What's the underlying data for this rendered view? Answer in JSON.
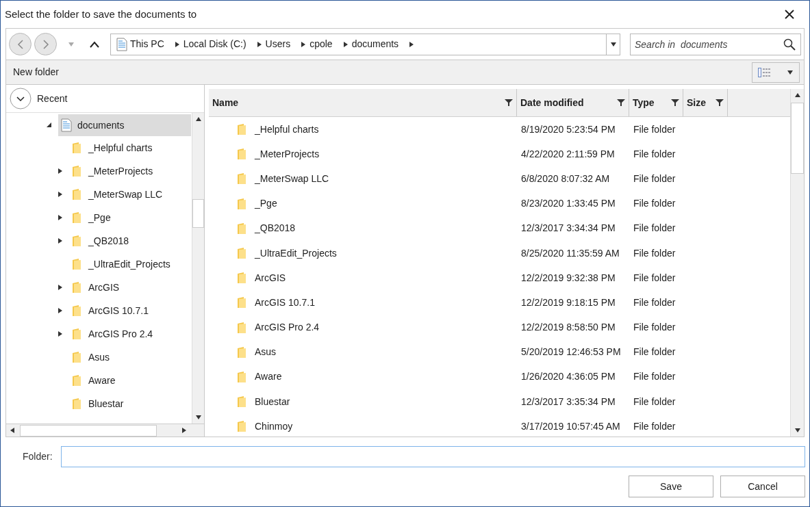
{
  "window": {
    "title": "Select the folder to save the documents to"
  },
  "breadcrumb": [
    "This PC",
    "Local Disk (C:)",
    "Users",
    "cpole",
    "documents"
  ],
  "search": {
    "placeholder": "Search in  documents"
  },
  "toolbar": {
    "new_folder": "New folder"
  },
  "recent": {
    "label": "Recent",
    "expanded": false
  },
  "tree": [
    {
      "label": "documents",
      "selected": true,
      "expanded": true,
      "children": [
        {
          "label": "_Helpful charts",
          "selected": false,
          "expandable": false
        },
        {
          "label": "_MeterProjects",
          "selected": false,
          "expandable": true
        },
        {
          "label": "_MeterSwap LLC",
          "selected": false,
          "expandable": true
        },
        {
          "label": "_Pge",
          "selected": false,
          "expandable": true
        },
        {
          "label": "_QB2018",
          "selected": false,
          "expandable": true
        },
        {
          "label": "_UltraEdit_Projects",
          "selected": false,
          "expandable": false
        },
        {
          "label": "ArcGIS",
          "selected": false,
          "expandable": true
        },
        {
          "label": "ArcGIS 10.7.1",
          "selected": false,
          "expandable": true
        },
        {
          "label": "ArcGIS Pro 2.4",
          "selected": false,
          "expandable": true
        },
        {
          "label": "Asus",
          "selected": false,
          "expandable": false
        },
        {
          "label": "Aware",
          "selected": false,
          "expandable": false
        },
        {
          "label": "Bluestar",
          "selected": false,
          "expandable": false
        }
      ]
    }
  ],
  "table": {
    "columns": [
      "Name",
      "Date modified",
      "Type",
      "Size"
    ],
    "rows": [
      [
        "_Helpful charts",
        "8/19/2020 5:23:54 PM",
        "File folder"
      ],
      [
        "_MeterProjects",
        "4/22/2020 2:11:59 PM",
        "File folder"
      ],
      [
        "_MeterSwap LLC",
        "6/8/2020 8:07:32 AM",
        "File folder"
      ],
      [
        "_Pge",
        "8/23/2020 1:33:45 PM",
        "File folder"
      ],
      [
        "_QB2018",
        "12/3/2017 3:34:34 PM",
        "File folder"
      ],
      [
        "_UltraEdit_Projects",
        "8/25/2020 11:35:59 AM",
        "File folder"
      ],
      [
        "ArcGIS",
        "12/2/2019 9:32:38 PM",
        "File folder"
      ],
      [
        "ArcGIS 10.7.1",
        "12/2/2019 9:18:15 PM",
        "File folder"
      ],
      [
        "ArcGIS Pro 2.4",
        "12/2/2019 8:58:50 PM",
        "File folder"
      ],
      [
        "Asus",
        "5/20/2019 12:46:53 PM",
        "File folder"
      ],
      [
        "Aware",
        "1/26/2020 4:36:05 PM",
        "File folder"
      ],
      [
        "Bluestar",
        "12/3/2017 3:35:34 PM",
        "File folder"
      ],
      [
        "Chinmoy",
        "3/17/2019 10:57:45 AM",
        "File folder"
      ]
    ]
  },
  "folder_field": {
    "label": "Folder:"
  },
  "buttons": [
    "Save",
    "Cancel"
  ]
}
